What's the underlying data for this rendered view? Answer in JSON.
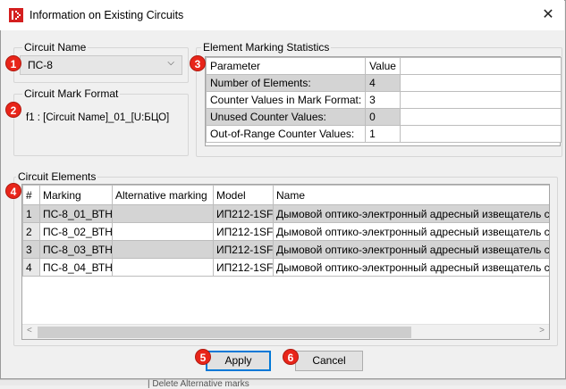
{
  "window": {
    "title": "Information on Existing Circuits"
  },
  "circuit_name": {
    "legend": "Circuit Name",
    "selected": "ПС-8"
  },
  "mark_format": {
    "legend": "Circuit Mark Format",
    "value": "f1 : [Circuit Name]_01_[U:БЦО]"
  },
  "stats": {
    "legend": "Element Marking Statistics",
    "headers": {
      "parameter": "Parameter",
      "value": "Value"
    },
    "rows": [
      {
        "parameter": "Number of Elements:",
        "value": "4"
      },
      {
        "parameter": "Counter Values in Mark Format:",
        "value": "3"
      },
      {
        "parameter": "Unused Counter Values:",
        "value": "0"
      },
      {
        "parameter": "Out-of-Range Counter Values:",
        "value": "1"
      }
    ]
  },
  "elements": {
    "legend": "Circuit Elements",
    "headers": {
      "num": "#",
      "marking": "Marking",
      "alt": "Alternative marking",
      "model": "Model",
      "name": "Name"
    },
    "rows": [
      {
        "num": "1",
        "marking": "ПС-8_01_ВТН",
        "alt": "",
        "model": "ИП212-1SF",
        "name": "Дымовой оптико-электронный адресный извещатель с"
      },
      {
        "num": "2",
        "marking": "ПС-8_02_ВТН",
        "alt": "",
        "model": "ИП212-1SF",
        "name": "Дымовой оптико-электронный адресный извещатель с"
      },
      {
        "num": "3",
        "marking": "ПС-8_03_ВТН",
        "alt": "",
        "model": "ИП212-1SF",
        "name": "Дымовой оптико-электронный адресный извещатель с"
      },
      {
        "num": "4",
        "marking": "ПС-8_04_ВТН",
        "alt": "",
        "model": "ИП212-1SF",
        "name": "Дымовой оптико-электронный адресный извещатель с"
      }
    ]
  },
  "buttons": {
    "apply": "Apply",
    "cancel": "Cancel"
  },
  "markers": [
    "1",
    "2",
    "3",
    "4",
    "5",
    "6"
  ],
  "background_text": "| Delete Alternative marks",
  "colors": {
    "marker": "#e8251a",
    "row_alt": "#d4d4d4",
    "default_button_border": "#0078d7"
  }
}
